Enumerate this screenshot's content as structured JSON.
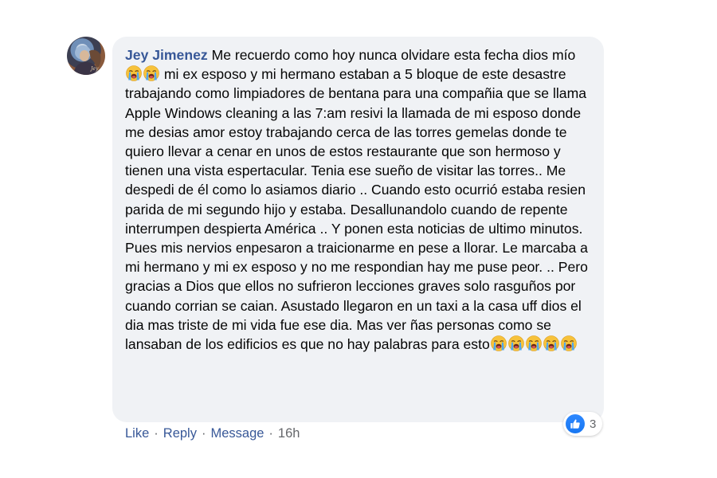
{
  "comment": {
    "author": "Jey Jimenez",
    "segments": [
      "Me recuerdo como hoy nunca olvidare esta fecha dios mío ",
      " mi ex esposo y mi hermano estaban a 5 bloque de este desastre trabajando como limpiadores de bentana para una compañia que se llama Apple Windows cleaning a las 7:am resivi la llamada de mi esposo donde me desias amor estoy trabajando cerca de las torres gemelas donde te quiero llevar a cenar en unos de estos restaurante que son hermoso y tienen una vista espertacular. Tenia ese sueño de visitar las torres.. Me despedi de él como lo asiamos diario .. Cuando esto ocurrió estaba resien parida de mi segundo hijo y estaba. Desallunandolo cuando de repente interrumpen despierta América .. Y ponen esta noticias de ultimo minutos. Pues mis nervios enpesaron a traicionarme en pese a llorar. Le marcaba a mi hermano y mi ex esposo y no me respondian hay me puse peor. .. Pero gracias a Dios que ellos no sufrieron lecciones graves solo rasguños por cuando corrian se caian. Asustado llegaron en un taxi a la casa uff dios el dia mas triste de mi vida fue ese dia. Mas ver ñas personas como se lansaban de los edificios es que no hay palabras para esto"
    ],
    "emoji_icon": "loudly-crying-face-icon"
  },
  "reactions": {
    "icon": "like-icon",
    "count": "3"
  },
  "actions": {
    "like": "Like",
    "reply": "Reply",
    "message": "Message",
    "separator": "·",
    "timestamp": "16h"
  },
  "colors": {
    "bubble": "#f0f2f5",
    "author": "#385898",
    "link": "#385898",
    "muted": "#65676b",
    "like_blue": "#1877f2"
  }
}
